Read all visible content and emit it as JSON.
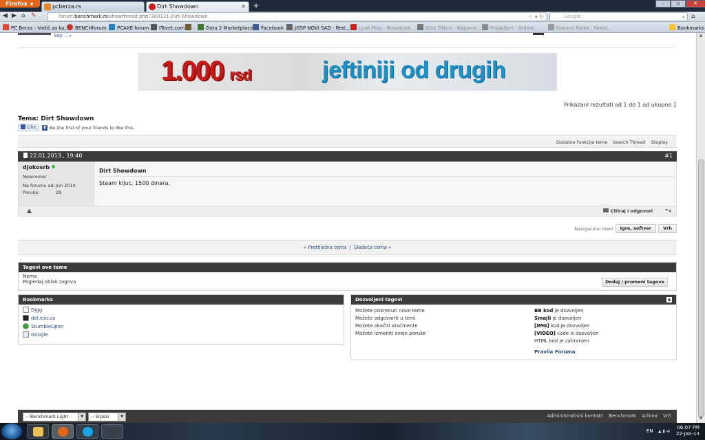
{
  "browser": {
    "app_button": "Firefox",
    "tabs": [
      {
        "label": "pcberza.rs"
      },
      {
        "label": "Dirt Showdown"
      }
    ],
    "url_prefix": "forum.",
    "url_domain": "benchmark.rs",
    "url_rest": "/showthread.php?300121-Dirt-Showdown",
    "search_placeholder": "Google",
    "bookmarks": [
      {
        "label": "PC Berza - Vodič za ku...",
        "color": "#d9483b"
      },
      {
        "label": "BENCHforum",
        "color": "#c0392b"
      },
      {
        "label": "PCAXE forum",
        "color": "#2c7fb8"
      },
      {
        "label": "ITsvet.com",
        "color": "#555555"
      },
      {
        "label": "Dota 2 Marketplace",
        "color": "#3b7a2e"
      },
      {
        "label": "Facebook",
        "color": "#3b5998"
      },
      {
        "label": "JGSP NOVI SAD - Red...",
        "color": "#666666"
      },
      {
        "label": "Ljudi Play - Broadcast ...",
        "color": "#cc1f1f"
      },
      {
        "label": "Divx Titlovi - Najvece...",
        "color": "#777777"
      },
      {
        "label": "Prijavljeni - Online...",
        "color": "#888888"
      },
      {
        "label": "Osnove Fizike - Fakto...",
        "color": "#999999"
      },
      {
        "label": "Bookmarks",
        "color": "#f0c33c"
      }
    ]
  },
  "page": {
    "top_fragment": "koji ...»",
    "banner": {
      "price": "1.000",
      "price_unit": "rsd",
      "slogan": "jeftiniji od drugih"
    },
    "results": "Prikazani rezultati od 1 do 1 od ukupno 1",
    "thread_title": "Tema: Dirt Showdown",
    "fb_like": "Like",
    "fb_text": "Be the first of your friends to like this.",
    "tools": {
      "extra": "Dodatne funkcije teme",
      "search": "Search Thread",
      "display": "Display"
    },
    "post": {
      "date": "22.01.2013., 19:40",
      "number": "#1",
      "username": "djokosrb",
      "rank": "Newcomer",
      "joined_label": "Na forumu od:",
      "joined_value": "Jun 2010",
      "posts_label": "Poruka:",
      "posts_value": "29",
      "title": "Dirt Showdown",
      "text": "Steam kljuc, 1500 dinara.",
      "quote_label": "Citiraj i odgovori"
    },
    "navmenu": {
      "label": "Navigacioni meni",
      "category": "Igre, softver",
      "top": "Vrh"
    },
    "prev_next": {
      "prev": "« Prethodna tema",
      "separator": "|",
      "next": "Sledeća tema »"
    },
    "tags": {
      "header": "Tagovi ove teme",
      "none": "Nema",
      "cloud": "Pogledaj oblak tagova",
      "edit_button": "Dodaj / promeni tagove"
    },
    "bookmarks": {
      "header": "Bookmarks",
      "items": [
        "Digg",
        "del.icio.us",
        "StumbleUpon",
        "Google"
      ]
    },
    "allowed": {
      "header": "Dozvoljeni tagovi",
      "perms": [
        "Možete pokrenuti nove teme",
        "Možete odgovoriti u temi",
        "Možete okačiti atačmente",
        "Možete izmeniti svoje poruke"
      ],
      "codes": [
        {
          "code": "BB kod",
          "rest": " je dozvoljen"
        },
        {
          "code": "Smajli",
          "rest": " je dozvoljen"
        },
        {
          "code": "[IMG]",
          "rest": " kod je dozvoljen"
        },
        {
          "code": "[VIDEO]",
          "rest": " code is dozvoljen"
        },
        {
          "code": "",
          "rest": "HTML kod je zabranjen"
        }
      ],
      "rules": "Pravila Foruma"
    },
    "footer": {
      "style_select": "-- Benchmark Light",
      "lang_select": "-- Srpski",
      "links": [
        "Administrativni kontakt",
        "Benchmark",
        "Arhiva",
        "Vrh"
      ]
    }
  },
  "taskbar": {
    "lang": "EN",
    "time": "06:07 PM",
    "date": "22-Jan-13"
  }
}
